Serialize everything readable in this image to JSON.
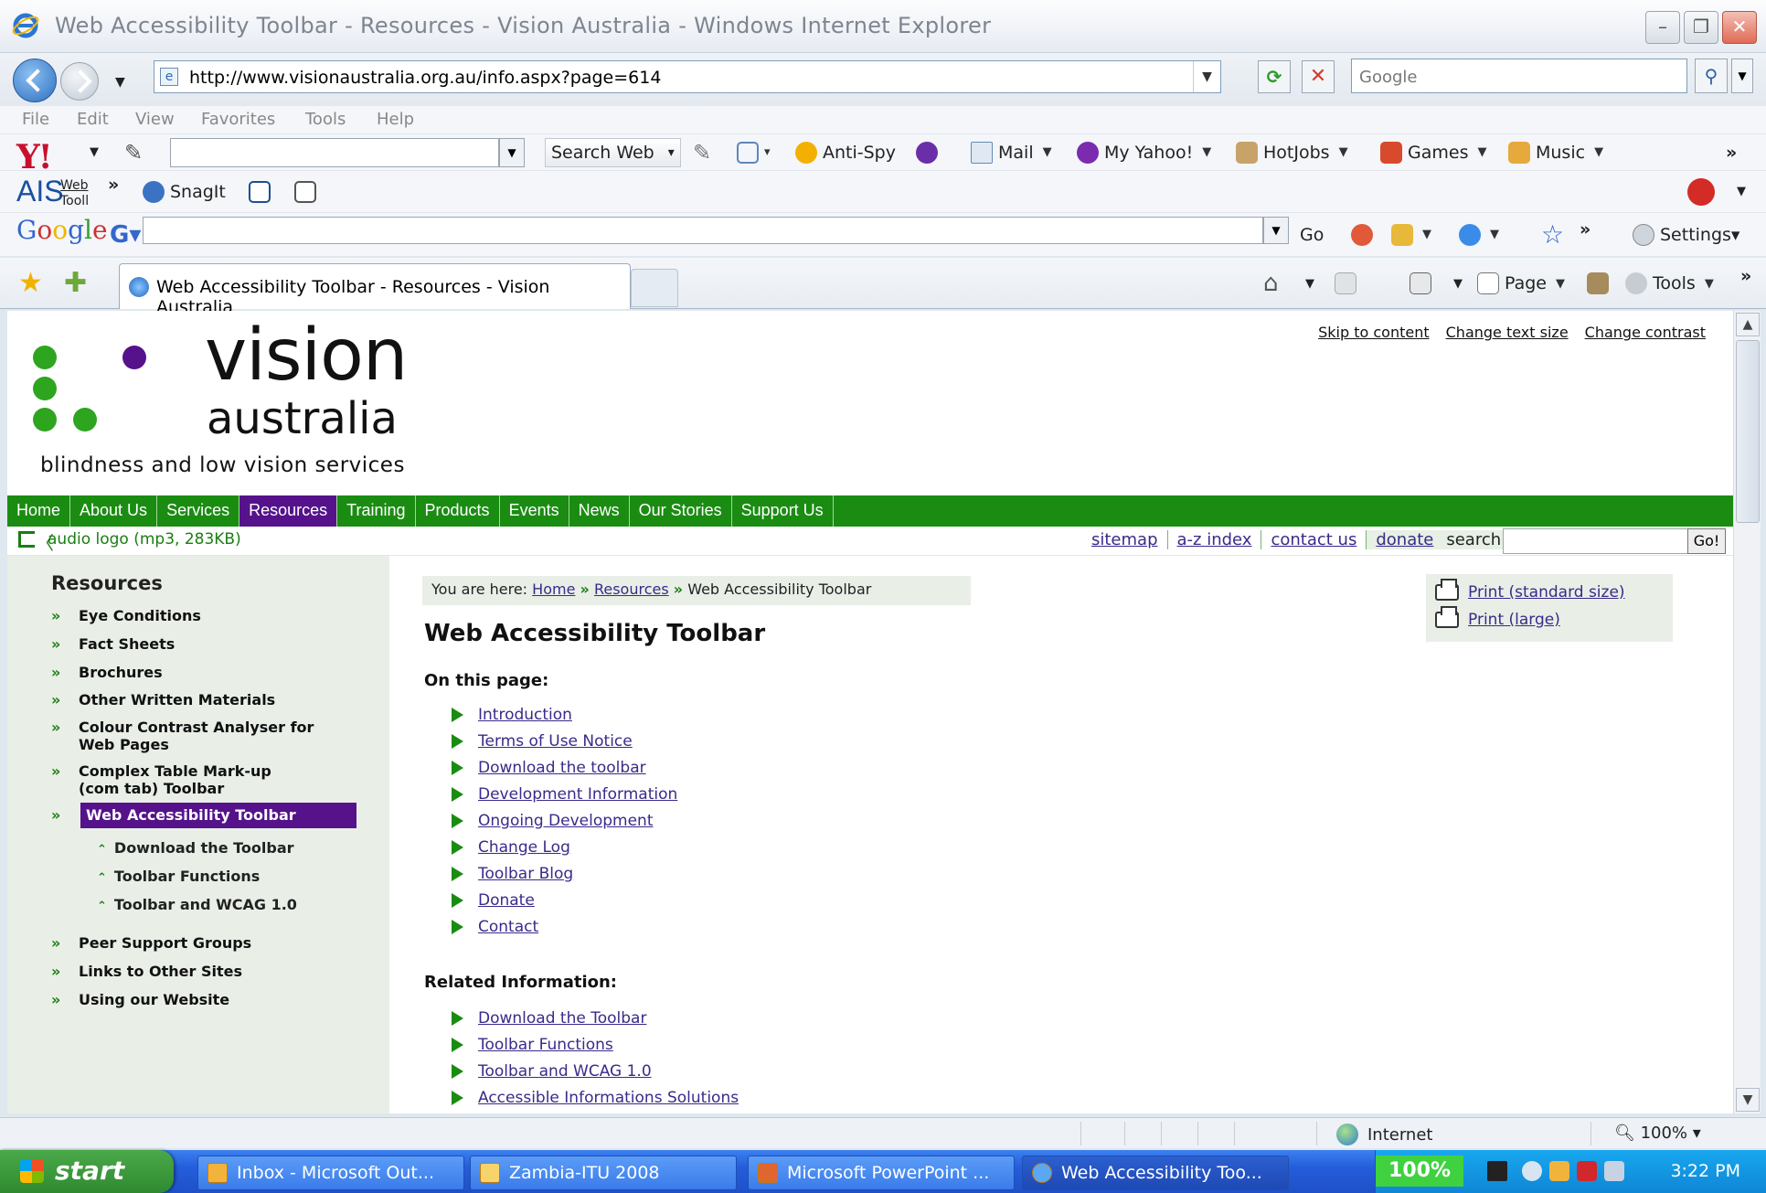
{
  "window": {
    "title": "Web Accessibility Toolbar - Resources - Vision Australia - Windows Internet Explorer",
    "minimize": "–",
    "maximize": "❐",
    "close": "✕"
  },
  "address_bar": {
    "url": "http://www.visionaustralia.org.au/info.aspx?page=614",
    "search_placeholder": "Google"
  },
  "menu": [
    "File",
    "Edit",
    "View",
    "Favorites",
    "Tools",
    "Help"
  ],
  "yahoo_toolbar": {
    "logo": "Y!",
    "search_label": "Search Web",
    "anti_spy": "Anti-Spy",
    "mail": "Mail",
    "my_yahoo": "My Yahoo!",
    "hotjobs": "HotJobs",
    "games": "Games",
    "music": "Music",
    "more": "»"
  },
  "ais_toolbar": {
    "logo": "AIS",
    "web_label": "Web",
    "tooll_label": "Tooll",
    "more": "»",
    "snagit": "SnagIt"
  },
  "google_toolbar": {
    "logo_chars": [
      "G",
      "o",
      "o",
      "g",
      "l",
      "e"
    ],
    "logo_colors": [
      "#3466cc",
      "#cc3333",
      "#f1b500",
      "#3466cc",
      "#33a033",
      "#cc3333"
    ],
    "go_label": "Go",
    "settings_label": "Settings▾",
    "more": "»"
  },
  "tabs": {
    "active_label": "Web Accessibility Toolbar - Resources - Vision Australia",
    "page_label": "Page",
    "tools_label": "Tools",
    "more": "»"
  },
  "site": {
    "logo_word1": "vision",
    "logo_word2": "australia",
    "tagline": "blindness and low vision services",
    "logo_colors": {
      "green": "#2ea51f",
      "purple": "#55128b"
    },
    "top_links": [
      "Skip to content",
      "Change text size",
      "Change contrast"
    ],
    "nav": [
      "Home",
      "About Us",
      "Services",
      "Resources",
      "Training",
      "Products",
      "Events",
      "News",
      "Our Stories",
      "Support Us"
    ],
    "nav_active": "Resources",
    "audio_logo": "audio logo (mp3, 283KB)",
    "util_links": [
      "sitemap",
      "a-z index",
      "contact us",
      "donate"
    ],
    "search_label": "search",
    "go_label": "Go!"
  },
  "sidebar": {
    "title": "Resources",
    "items_top": [
      "Eye Conditions",
      "Fact Sheets",
      "Brochures",
      "Other Written Materials",
      "Colour Contrast Analyser for Web Pages",
      "Complex Table Mark-up (com tab) Toolbar"
    ],
    "selected": "Web Accessibility Toolbar",
    "sub_items": [
      "Download the Toolbar",
      "Toolbar Functions",
      "Toolbar and WCAG 1.0"
    ],
    "items_bottom": [
      "Peer Support Groups",
      "Links to Other Sites",
      "Using our Website"
    ]
  },
  "content": {
    "breadcrumb_prefix": "You are here:",
    "breadcrumb_home": "Home",
    "breadcrumb_resources": "Resources",
    "breadcrumb_current": "Web Accessibility Toolbar",
    "breadcrumb_sep": "»",
    "title": "Web Accessibility Toolbar",
    "on_this_page_heading": "On this page:",
    "on_this_page": [
      "Introduction",
      "Terms of Use Notice",
      "Download the toolbar",
      "Development Information",
      "Ongoing Development",
      "Change Log",
      "Toolbar Blog",
      "Donate",
      "Contact"
    ],
    "related_heading": "Related Information:",
    "related": [
      "Download the Toolbar",
      "Toolbar Functions",
      "Toolbar and WCAG 1.0",
      "Accessible Informations Solutions"
    ],
    "print_standard": "Print (standard size)",
    "print_large": "Print (large)"
  },
  "status_bar": {
    "zone": "Internet",
    "zoom": "100%"
  },
  "taskbar": {
    "start": "start",
    "buttons": [
      "Inbox - Microsoft Out...",
      "Zambia-ITU 2008",
      "Microsoft PowerPoint ...",
      "Web Accessibility Too..."
    ],
    "battery": "100%",
    "clock": "3:22 PM"
  }
}
